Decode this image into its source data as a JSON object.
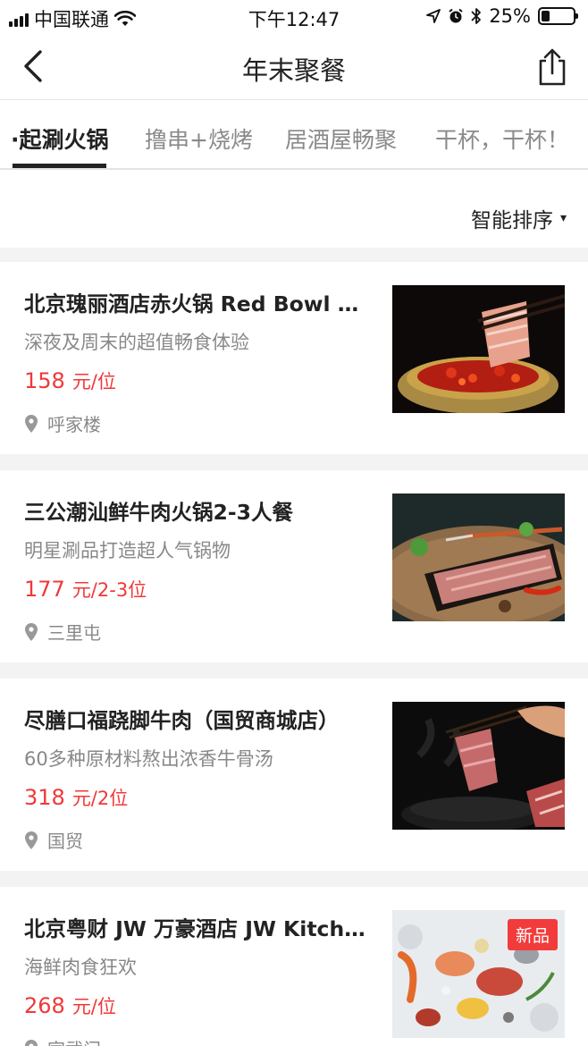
{
  "status_bar": {
    "carrier": "中国联通",
    "time": "下午12:47",
    "battery": "25%",
    "battery_level": 0.25
  },
  "nav": {
    "title": "年末聚餐",
    "back_icon": "chevron-left-icon",
    "share_icon": "share-icon"
  },
  "tabs": [
    {
      "label": "·起涮火锅",
      "active": true
    },
    {
      "label": "撸串+烧烤",
      "active": false
    },
    {
      "label": "居酒屋畅聚",
      "active": false
    },
    {
      "label": "干杯，干杯！",
      "active": false
    }
  ],
  "sort": {
    "label": "智能排序",
    "arrow": "▾"
  },
  "items": [
    {
      "title": "北京瑰丽酒店赤火锅 Red Bowl Hotpot",
      "subtitle": "深夜及周末的超值畅食体验",
      "price": "158",
      "unit": "元/位",
      "location": "呼家楼",
      "badge": ""
    },
    {
      "title": "三公潮汕鲜牛肉火锅2-3人餐",
      "subtitle": "明星涮品打造超人气锅物",
      "price": "177",
      "unit": "元/2-3位",
      "location": "三里屯",
      "badge": ""
    },
    {
      "title": "尽膳口福跷脚牛肉（国贸商城店）",
      "subtitle": "60多种原材料熬出浓香牛骨汤",
      "price": "318",
      "unit": "元/2位",
      "location": "国贸",
      "badge": ""
    },
    {
      "title": "北京粤财 JW 万豪酒店 JW Kitchen",
      "subtitle": "海鲜肉食狂欢",
      "price": "268",
      "unit": "元/位",
      "location": "宣武门",
      "badge": "新品"
    }
  ],
  "colors": {
    "price": "#f03838",
    "badge": "#f23b3b",
    "separator": "#f3f3f3"
  }
}
